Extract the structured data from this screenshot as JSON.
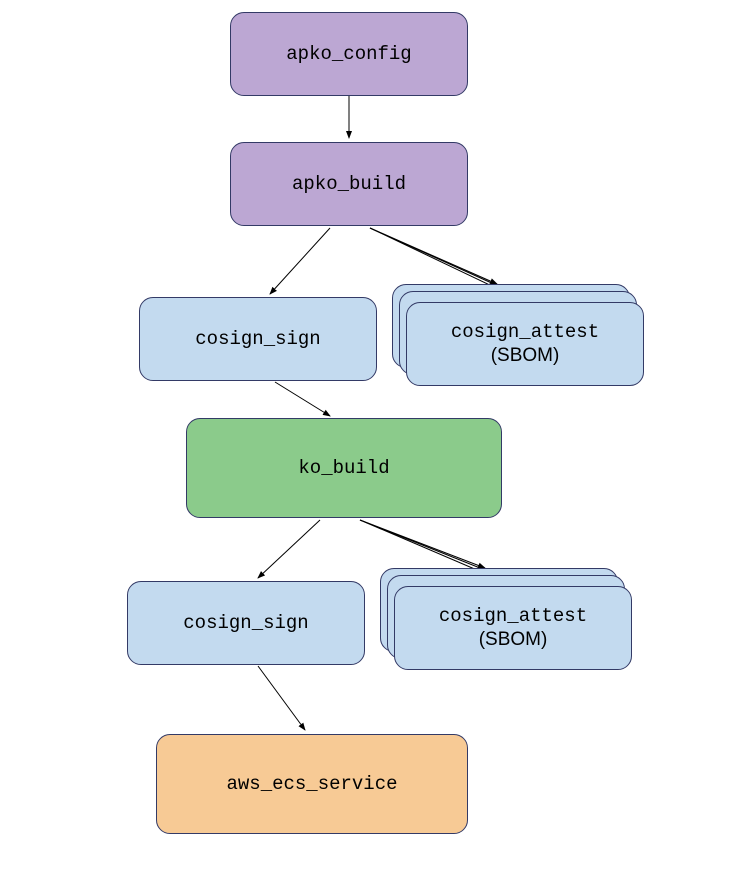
{
  "diagram": {
    "type": "flowchart",
    "nodes": {
      "apko_config": {
        "label": "apko_config",
        "color": "purple"
      },
      "apko_build": {
        "label": "apko_build",
        "color": "purple"
      },
      "cosign_sign_1": {
        "label": "cosign_sign",
        "color": "blue"
      },
      "cosign_attest_1": {
        "label": "cosign_attest",
        "sublabel": "(SBOM)",
        "color": "blue",
        "stacked": true
      },
      "ko_build": {
        "label": "ko_build",
        "color": "green"
      },
      "cosign_sign_2": {
        "label": "cosign_sign",
        "color": "blue"
      },
      "cosign_attest_2": {
        "label": "cosign_attest",
        "sublabel": "(SBOM)",
        "color": "blue",
        "stacked": true
      },
      "aws_ecs_service": {
        "label": "aws_ecs_service",
        "color": "orange"
      }
    },
    "edges": [
      {
        "from": "apko_config",
        "to": "apko_build"
      },
      {
        "from": "apko_build",
        "to": "cosign_sign_1"
      },
      {
        "from": "apko_build",
        "to": "cosign_attest_1",
        "multi": 3
      },
      {
        "from": "cosign_sign_1",
        "to": "ko_build"
      },
      {
        "from": "ko_build",
        "to": "cosign_sign_2"
      },
      {
        "from": "ko_build",
        "to": "cosign_attest_2",
        "multi": 3
      },
      {
        "from": "cosign_sign_2",
        "to": "aws_ecs_service"
      }
    ]
  }
}
